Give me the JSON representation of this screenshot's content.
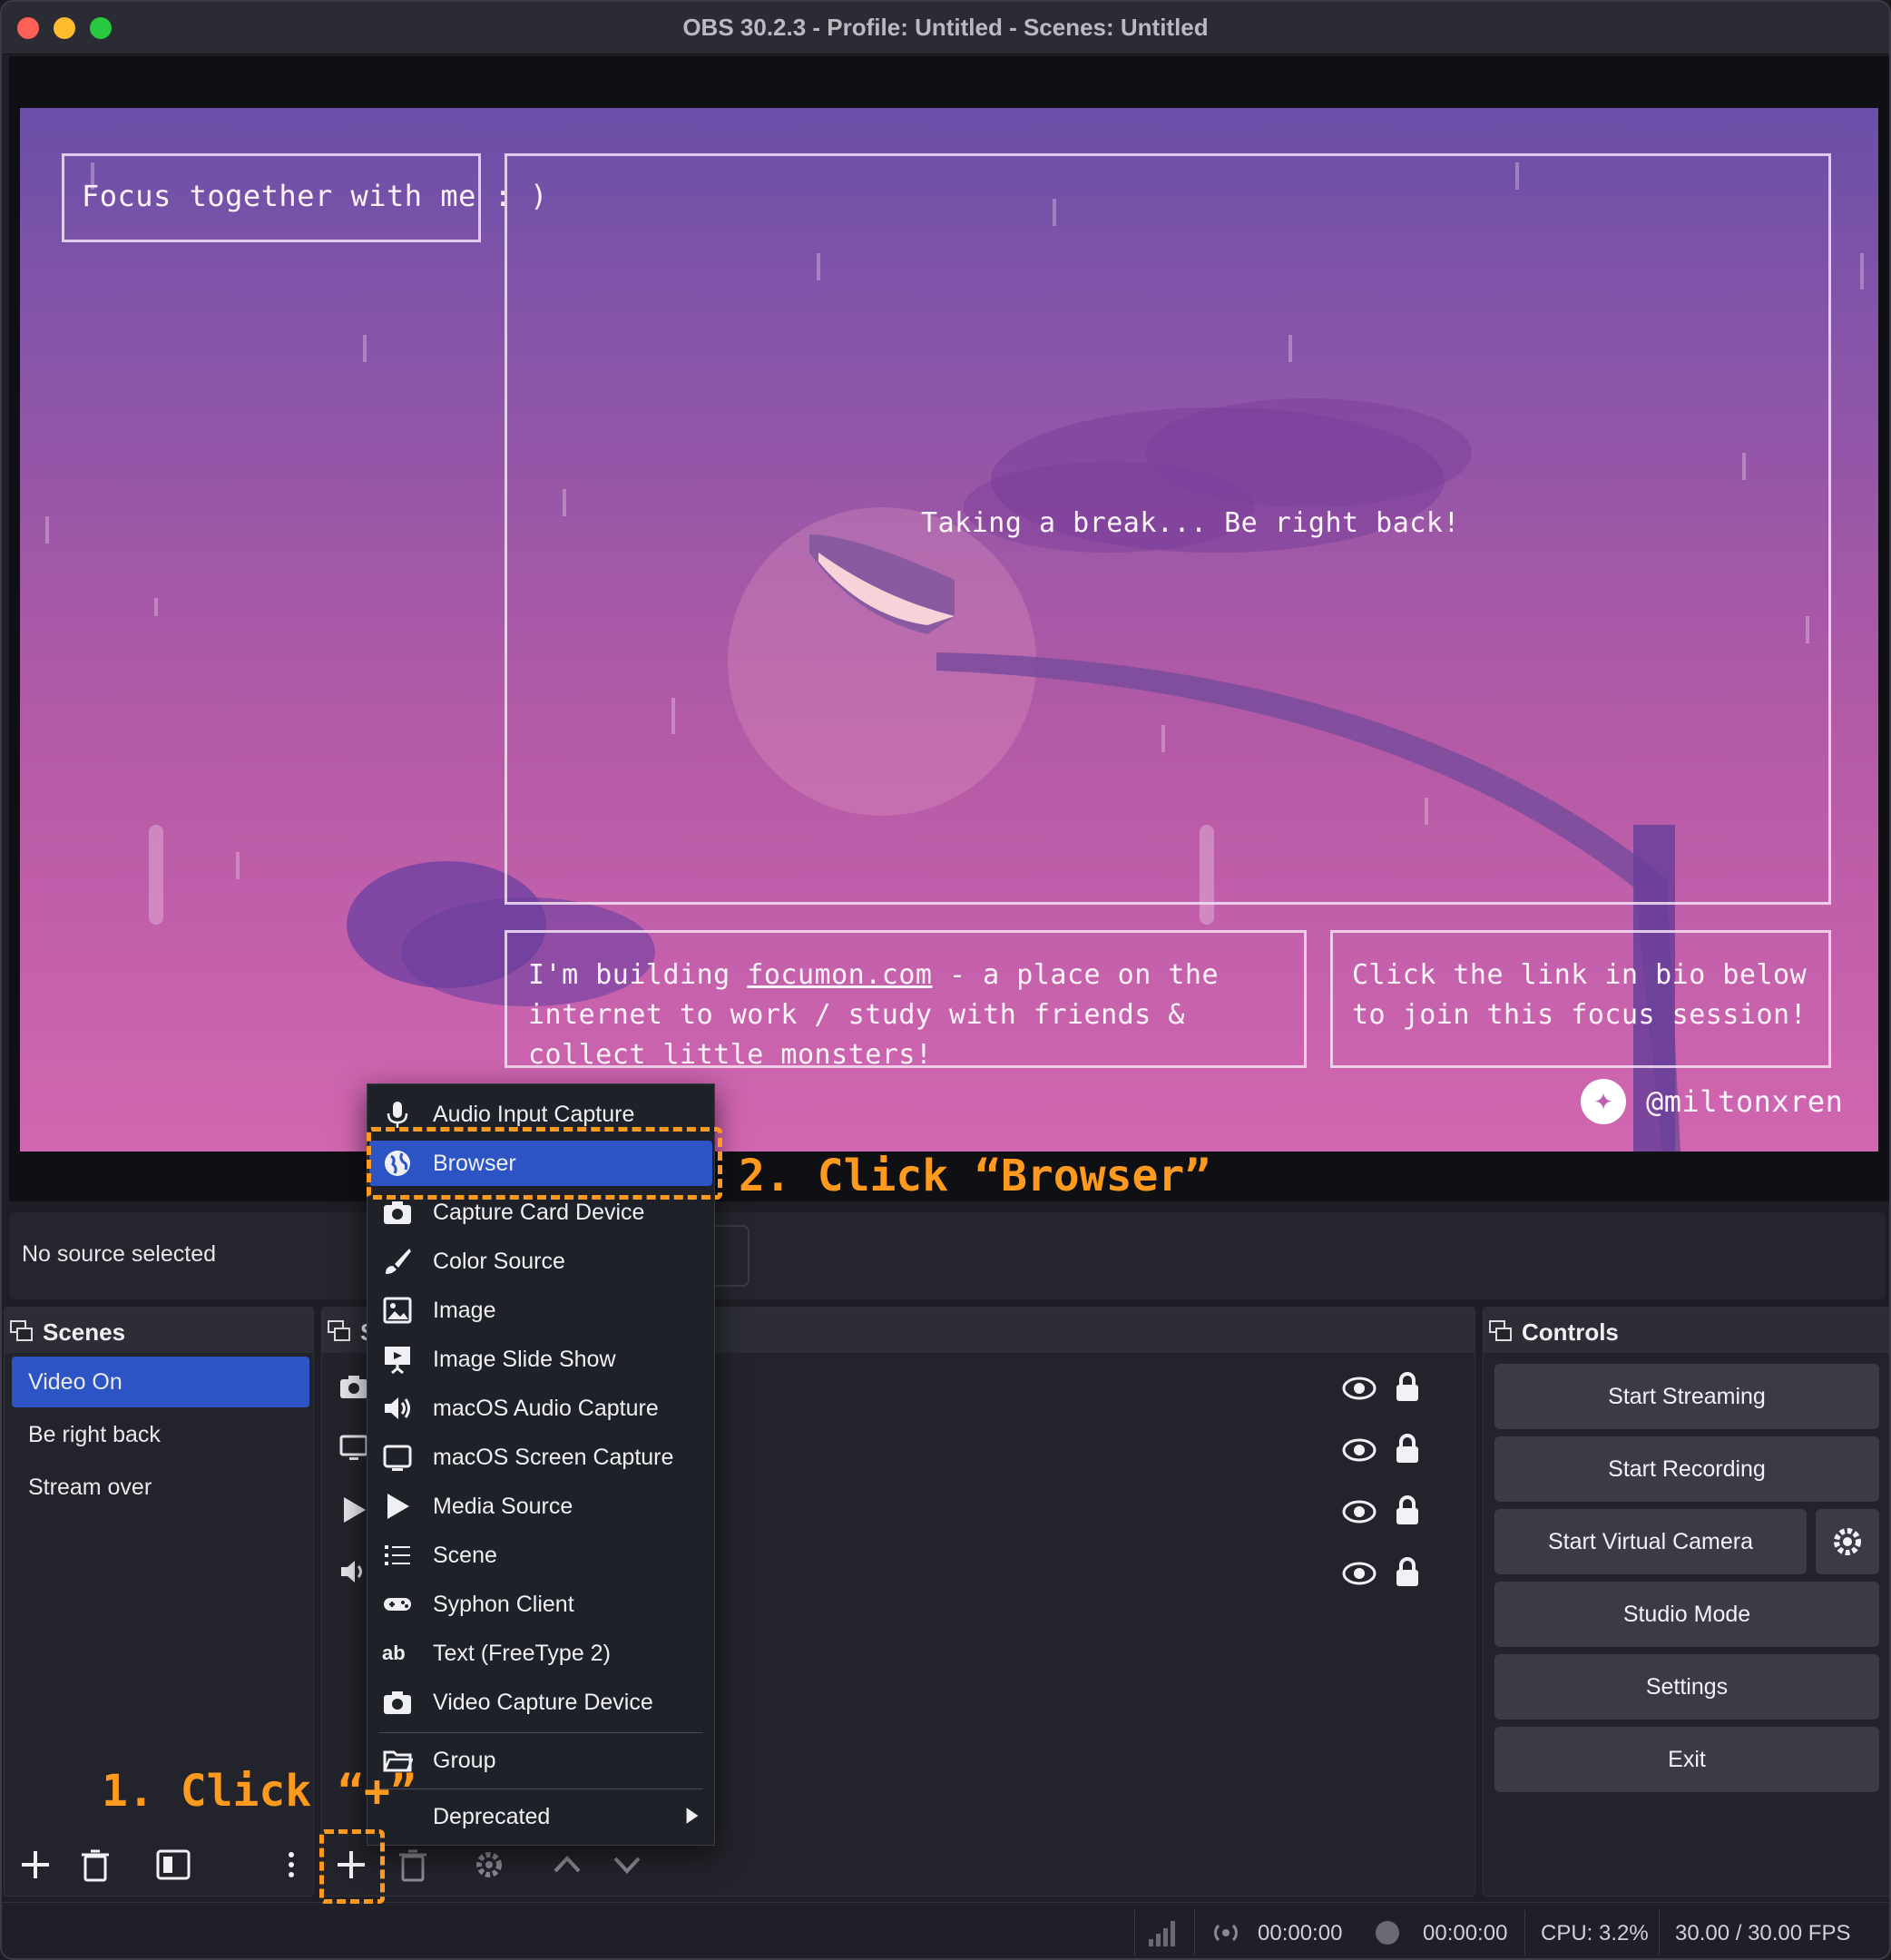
{
  "window": {
    "title": "OBS 30.2.3 - Profile: Untitled - Scenes: Untitled"
  },
  "preview": {
    "title_text": "Focus together with me : )",
    "center_text": "Taking a break... Be right back!",
    "info_before": "I'm building ",
    "info_link": "focumon.com",
    "info_after": " - a place on the internet to work / study with friends & collect little monsters!",
    "cta_text": "Click the link in bio below to join this focus session!",
    "handle": "@miltonxren"
  },
  "source_bar": {
    "status": "No source selected"
  },
  "scenes": {
    "title": "Scenes",
    "items": [
      {
        "label": "Video On",
        "active": true
      },
      {
        "label": "Be right back",
        "active": false
      },
      {
        "label": "Stream over",
        "active": false
      }
    ]
  },
  "sources": {
    "title_initial": "S",
    "rows": [
      {
        "icon": "camera-icon"
      },
      {
        "icon": "monitor-icon"
      },
      {
        "icon": "play-icon"
      },
      {
        "icon": "speaker-icon"
      }
    ]
  },
  "controls": {
    "title": "Controls",
    "start_streaming": "Start Streaming",
    "start_recording": "Start Recording",
    "start_virtual_camera": "Start Virtual Camera",
    "studio_mode": "Studio Mode",
    "settings": "Settings",
    "exit": "Exit"
  },
  "menu": {
    "items": [
      {
        "label": "Audio Input Capture",
        "icon": "microphone-icon"
      },
      {
        "label": "Browser",
        "icon": "globe-icon",
        "highlighted": true
      },
      {
        "label": "Capture Card Device",
        "icon": "camera-icon"
      },
      {
        "label": "Color Source",
        "icon": "brush-icon"
      },
      {
        "label": "Image",
        "icon": "image-icon"
      },
      {
        "label": "Image Slide Show",
        "icon": "slideshow-icon"
      },
      {
        "label": "macOS Audio Capture",
        "icon": "speaker-icon"
      },
      {
        "label": "macOS Screen Capture",
        "icon": "monitor-icon"
      },
      {
        "label": "Media Source",
        "icon": "play-icon"
      },
      {
        "label": "Scene",
        "icon": "list-icon"
      },
      {
        "label": "Syphon Client",
        "icon": "gamepad-icon"
      },
      {
        "label": "Text (FreeType 2)",
        "icon": "text-icon"
      },
      {
        "label": "Video Capture Device",
        "icon": "camera-icon"
      },
      {
        "label": "Group",
        "icon": "folder-icon"
      },
      {
        "label": "Deprecated",
        "icon": "submenu-arrow-icon"
      }
    ]
  },
  "annotations": {
    "step1": "1. Click “+”",
    "step2": "2. Click “Browser”"
  },
  "status": {
    "stream_time": "00:00:00",
    "record_time": "00:00:00",
    "cpu": "CPU: 3.2%",
    "fps": "30.00 / 30.00 FPS"
  },
  "colors": {
    "accent": "#2c54c4",
    "annotation": "#ff9a1f",
    "background": "#1e1f26"
  }
}
